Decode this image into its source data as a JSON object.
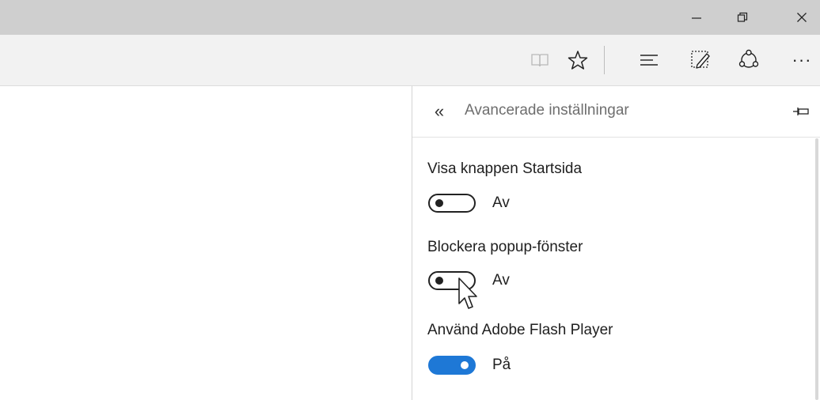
{
  "window": {
    "minimize_icon": "minimize-icon",
    "restore_icon": "restore-icon",
    "close_icon": "close-icon"
  },
  "toolbar": {
    "icons": [
      "reading-view-icon",
      "favorites-star-icon",
      "hub-icon",
      "web-note-icon",
      "share-icon",
      "more-icon"
    ],
    "more_label": "···"
  },
  "panel": {
    "back_glyph": "«",
    "title": "Avancerade inställningar",
    "settings": [
      {
        "label": "Visa knappen Startsida",
        "state": "Av",
        "on": false
      },
      {
        "label": "Blockera popup-fönster",
        "state": "Av",
        "on": false
      },
      {
        "label": "Använd Adobe Flash Player",
        "state": "På",
        "on": true
      }
    ]
  },
  "colors": {
    "titlebar": "#cfcfcf",
    "toolbar": "#f2f2f2",
    "toggle_on": "#1e78d6"
  }
}
